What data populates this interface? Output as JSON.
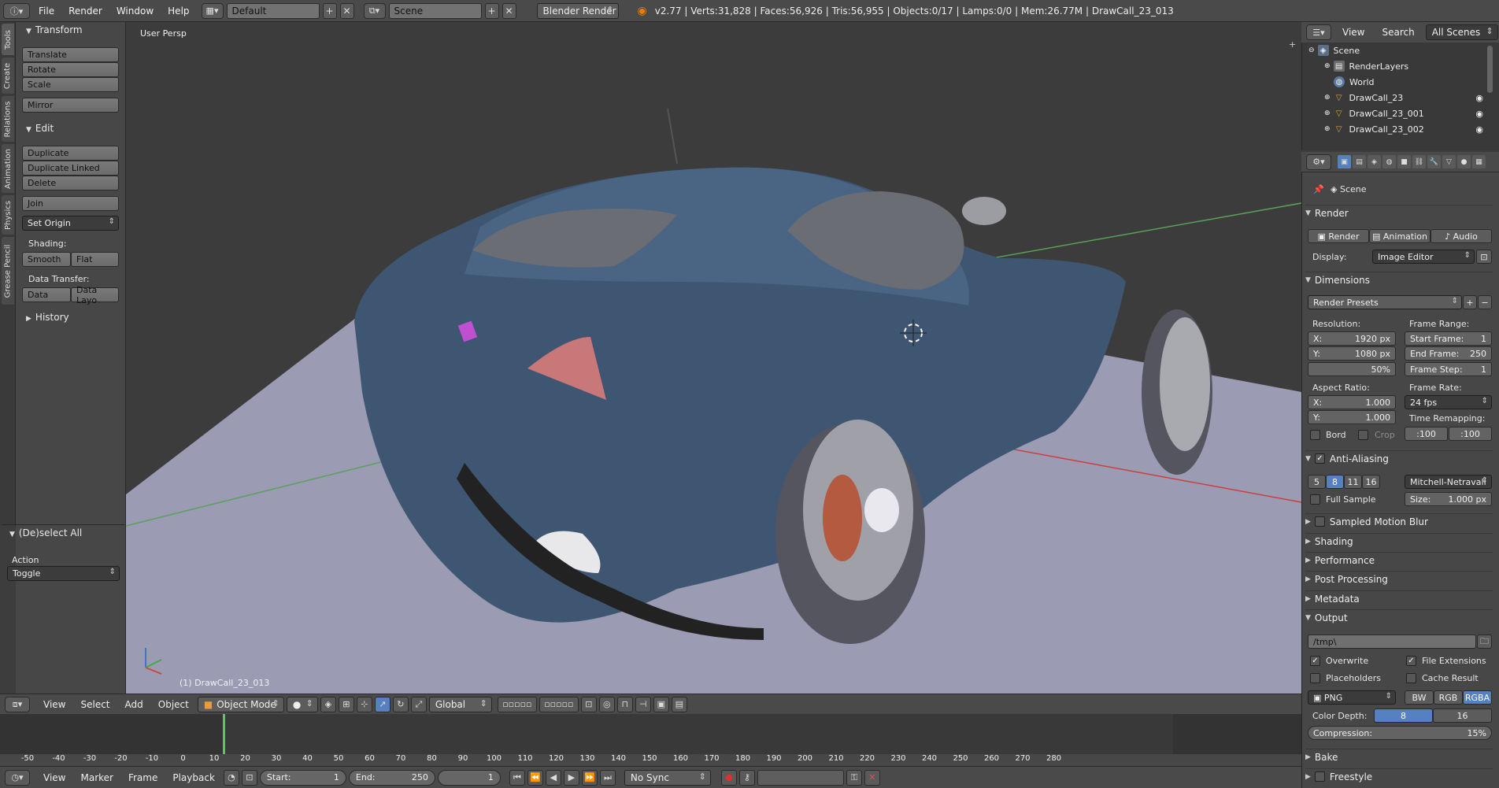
{
  "topbar": {
    "menus": [
      "File",
      "Render",
      "Window",
      "Help"
    ],
    "layout": "Default",
    "scene": "Scene",
    "engine": "Blender Render",
    "stats": "v2.77 | Verts:31,828 | Faces:56,926 | Tris:56,955 | Objects:0/17 | Lamps:0/0 | Mem:26.77M | DrawCall_23_013"
  },
  "shelf_tabs": [
    "Tools",
    "Create",
    "Relations",
    "Animation",
    "Physics",
    "Grease Pencil"
  ],
  "shelf": {
    "transform_title": "Transform",
    "translate": "Translate",
    "rotate": "Rotate",
    "scale": "Scale",
    "mirror": "Mirror",
    "edit_title": "Edit",
    "duplicate": "Duplicate",
    "duplicate_linked": "Duplicate Linked",
    "delete": "Delete",
    "join": "Join",
    "set_origin": "Set Origin",
    "shading_label": "Shading:",
    "smooth": "Smooth",
    "flat": "Flat",
    "data_transfer_label": "Data Transfer:",
    "data": "Data",
    "data_layo": "Data Layo",
    "history_title": "History",
    "op_title": "(De)select All",
    "action_label": "Action",
    "action_value": "Toggle"
  },
  "viewport": {
    "label": "User Persp",
    "object": "(1) DrawCall_23_013"
  },
  "view_header": {
    "menus": [
      "View",
      "Select",
      "Add",
      "Object"
    ],
    "mode": "Object Mode",
    "orientation": "Global"
  },
  "timeline": {
    "ticks": [
      "-50",
      "-40",
      "-30",
      "-20",
      "-10",
      "0",
      "10",
      "20",
      "30",
      "40",
      "50",
      "60",
      "70",
      "80",
      "90",
      "100",
      "110",
      "120",
      "130",
      "140",
      "150",
      "160",
      "170",
      "180",
      "190",
      "200",
      "210",
      "220",
      "230",
      "240",
      "250",
      "260",
      "270",
      "280"
    ],
    "menus": [
      "View",
      "Marker",
      "Frame",
      "Playback"
    ],
    "start_label": "Start:",
    "start_value": "1",
    "end_label": "End:",
    "end_value": "250",
    "current": "1",
    "sync": "No Sync",
    "current_frame_fraction": 0
  },
  "outliner": {
    "menus": [
      "View",
      "Search"
    ],
    "scope": "All Scenes",
    "items": [
      {
        "label": "Scene",
        "indent": 0
      },
      {
        "label": "RenderLayers",
        "indent": 1
      },
      {
        "label": "World",
        "indent": 1
      },
      {
        "label": "DrawCall_23",
        "indent": 1
      },
      {
        "label": "DrawCall_23_001",
        "indent": 1
      },
      {
        "label": "DrawCall_23_002",
        "indent": 1
      }
    ]
  },
  "properties": {
    "context": "Scene",
    "render_title": "Render",
    "render_btn": "Render",
    "animation_btn": "Animation",
    "audio_btn": "Audio",
    "display_label": "Display:",
    "display_value": "Image Editor",
    "dimensions_title": "Dimensions",
    "render_presets": "Render Presets",
    "resolution_label": "Resolution:",
    "res_x_label": "X:",
    "res_x": "1920 px",
    "res_y_label": "Y:",
    "res_y": "1080 px",
    "res_pct": "50%",
    "frame_range_label": "Frame Range:",
    "start_frame_label": "Start Frame:",
    "start_frame": "1",
    "end_frame_label": "End Frame:",
    "end_frame": "250",
    "frame_step_label": "Frame Step:",
    "frame_step": "1",
    "aspect_label": "Aspect Ratio:",
    "asp_x_label": "X:",
    "asp_x": "1.000",
    "asp_y_label": "Y:",
    "asp_y": "1.000",
    "frame_rate_label": "Frame Rate:",
    "frame_rate": "24 fps",
    "time_remap_label": "Time Remapping:",
    "remap_old": ":100",
    "remap_new": ":100",
    "bord": "Bord",
    "crop": "Crop",
    "aa_title": "Anti-Aliasing",
    "aa_levels": [
      "5",
      "8",
      "11",
      "16"
    ],
    "aa_filter": "Mitchell-Netravali",
    "full_sample": "Full Sample",
    "size_label": "Size:",
    "size_value": "1.000 px",
    "motion_blur": "Sampled Motion Blur",
    "shading": "Shading",
    "performance": "Performance",
    "post_processing": "Post Processing",
    "metadata": "Metadata",
    "output_title": "Output",
    "output_path": "/tmp\\",
    "overwrite": "Overwrite",
    "file_extensions": "File Extensions",
    "placeholders": "Placeholders",
    "cache_result": "Cache Result",
    "format": "PNG",
    "bw": "BW",
    "rgb": "RGB",
    "rgba": "RGBA",
    "color_depth_label": "Color Depth:",
    "depth_8": "8",
    "depth_16": "16",
    "compression_label": "Compression:",
    "compression_value": "15%",
    "bake": "Bake",
    "freestyle": "Freestyle"
  }
}
